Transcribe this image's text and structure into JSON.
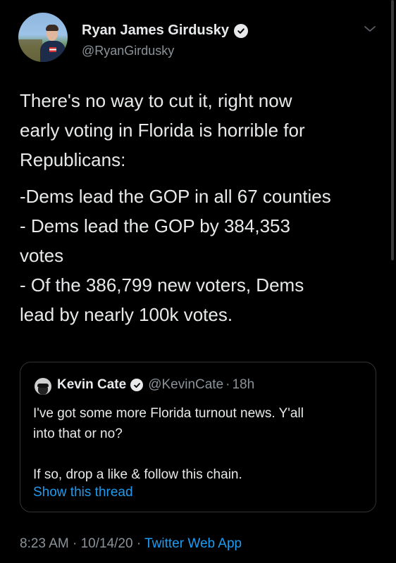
{
  "author": {
    "name": "Ryan James Girdusky",
    "handle": "@RyanGirdusky",
    "verified": true
  },
  "tweet": {
    "paragraphs": [
      "There's no way to cut it, right now early voting in Florida is horrible for Republicans:",
      "-Dems lead the GOP in all 67 counties\n- Dems lead the GOP by 384,353 votes\n- Of the 386,799 new voters, Dems lead by nearly 100k votes."
    ],
    "lines": [
      "There's no way to cut it, right now",
      "early voting in Florida is horrible for",
      "Republicans:",
      "-Dems lead the GOP in all 67 counties",
      "- Dems lead the GOP by 384,353",
      "votes",
      "- Of the 386,799 new voters, Dems",
      "lead by nearly 100k votes."
    ]
  },
  "quote": {
    "name": "Kevin Cate",
    "handle": "@KevinCate",
    "separator": "·",
    "time": "18h",
    "line1": "I've got some more Florida turnout news. Y'all",
    "line2": "into that or no?",
    "line3": "If so, drop a like & follow this chain.",
    "link": "Show this thread"
  },
  "meta": {
    "time": "8:23 AM",
    "sep1": "·",
    "date": "10/14/20",
    "sep2": "·",
    "source": "Twitter Web App"
  },
  "icons": {
    "verified": "verified-badge-icon",
    "menu": "chevron-down-icon"
  },
  "colors": {
    "background": "#000000",
    "text": "#e7e9ea",
    "secondary": "#8b9298",
    "link": "#1d9bf0"
  }
}
